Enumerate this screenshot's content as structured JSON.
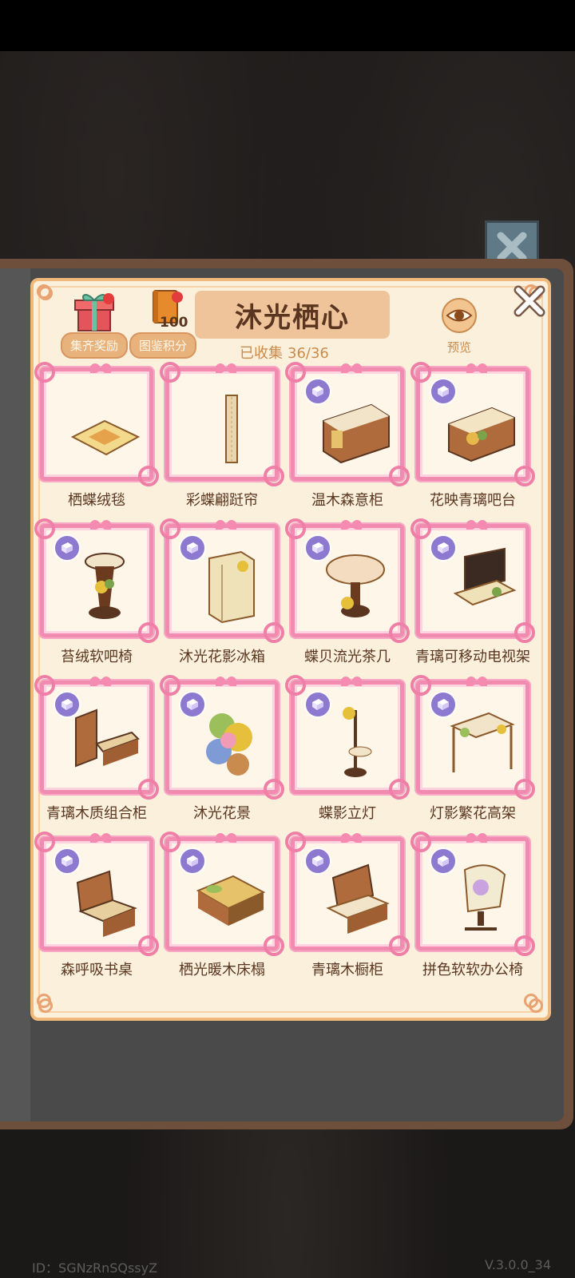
{
  "header": {
    "title": "沐光栖心",
    "collected_label": "已收集",
    "collected_value": "36/36",
    "reward_label": "集齐奖励",
    "points_label": "图鉴积分",
    "points_value": "100",
    "preview_label": "预览"
  },
  "items": [
    {
      "name": "栖蝶绒毯",
      "badge": false,
      "icon": "rug-icon"
    },
    {
      "name": "彩蝶翩跹帘",
      "badge": false,
      "icon": "curtain-icon"
    },
    {
      "name": "温木森意柜",
      "badge": true,
      "icon": "cabinet-icon"
    },
    {
      "name": "花映青璃吧台",
      "badge": true,
      "icon": "bar-counter-icon"
    },
    {
      "name": "苔绒软吧椅",
      "badge": true,
      "icon": "bar-stool-icon"
    },
    {
      "name": "沐光花影冰箱",
      "badge": true,
      "icon": "fridge-icon"
    },
    {
      "name": "蝶贝流光茶几",
      "badge": true,
      "icon": "tea-table-icon"
    },
    {
      "name": "青璃可移动电视架",
      "badge": true,
      "icon": "tv-stand-icon"
    },
    {
      "name": "青璃木质组合柜",
      "badge": true,
      "icon": "combo-cabinet-icon"
    },
    {
      "name": "沐光花景",
      "badge": true,
      "icon": "flower-scene-icon"
    },
    {
      "name": "蝶影立灯",
      "badge": true,
      "icon": "floor-lamp-icon"
    },
    {
      "name": "灯影繁花高架",
      "badge": true,
      "icon": "flower-arbor-icon"
    },
    {
      "name": "森呼吸书桌",
      "badge": true,
      "icon": "desk-icon"
    },
    {
      "name": "栖光暖木床榻",
      "badge": true,
      "icon": "bed-icon"
    },
    {
      "name": "青璃木橱柜",
      "badge": true,
      "icon": "kitchen-cabinet-icon"
    },
    {
      "name": "拼色软软办公椅",
      "badge": true,
      "icon": "office-chair-icon"
    }
  ],
  "footer": {
    "id_text": "ID：SGNzRnSQssyZ",
    "version": "V.3.0.0_34"
  },
  "colors": {
    "frame_pink": "#f28bb0",
    "panel_bg": "#fbf0dc",
    "title_bg": "#f0c49a",
    "text_brown": "#5a3620",
    "badge_purple": "#8d79cf"
  }
}
